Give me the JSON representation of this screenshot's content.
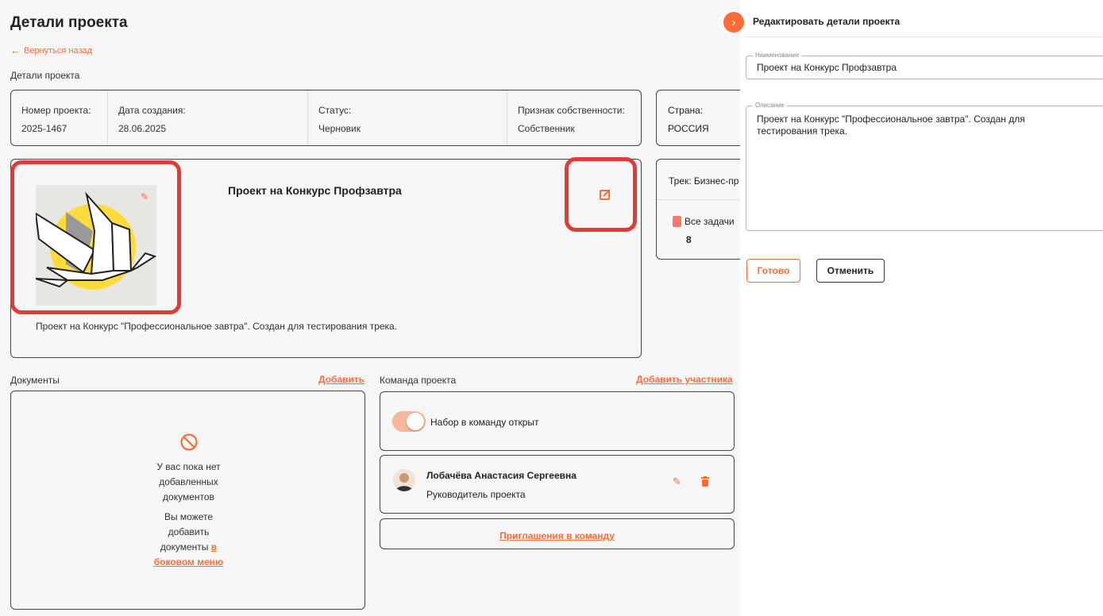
{
  "header": {
    "title": "Детали проекта",
    "back_link": "Вернуться назад",
    "section_label": "Детали проекта"
  },
  "info": [
    {
      "label": "Номер проекта:",
      "value": "2025-1467"
    },
    {
      "label": "Дата создания:",
      "value": "28.06.2025"
    },
    {
      "label": "Статус:",
      "value": "Черновик"
    },
    {
      "label": "Признак собственности:",
      "value": "Собственник"
    }
  ],
  "country": {
    "label": "Страна:",
    "value": "РОССИЯ"
  },
  "project": {
    "name": "Проект на Конкурс Профзавтра",
    "description": "Проект на Конкурс \"Профессиональное завтра\". Создан для тестирования трека."
  },
  "track": {
    "title": "Трек: Бизнес-пр",
    "tasks_label": "Все задачи",
    "tasks_count": "8"
  },
  "documents": {
    "label": "Документы",
    "add_link": "Добавить",
    "empty_text": "У вас пока нет добавленных документов",
    "hint_text": "Вы можете добавить документы",
    "hint_link": "в боковом меню"
  },
  "team": {
    "label": "Команда проекта",
    "add_link": "Добавить участника",
    "recruiting_label": "Набор в команду открыт",
    "recruiting_open": true,
    "member": {
      "name": "Лобачёва Анастасия Сергеевна",
      "role": "Руководитель проекта"
    },
    "invites_link": "Приглашения в команду"
  },
  "side_panel": {
    "title": "Редактировать детали проекта",
    "name_field": {
      "legend": "Наименование",
      "value": "Проект на Конкурс Профзавтра"
    },
    "desc_field": {
      "legend": "Описание",
      "value": "Проект на Конкурс \"Профессиональное завтра\". Создан для тестирования трека."
    },
    "done_button": "Готово",
    "cancel_button": "Отменить"
  },
  "colors": {
    "accent": "#ff6b35",
    "highlight": "#e53935",
    "toggle_track": "#f5b79a",
    "illustration_sun": "#fddb3a"
  },
  "icons": [
    "arrow-left-icon",
    "pencil-icon",
    "edit-square-icon",
    "tasks-icon",
    "ban-icon",
    "trash-icon",
    "chevron-right-icon"
  ]
}
